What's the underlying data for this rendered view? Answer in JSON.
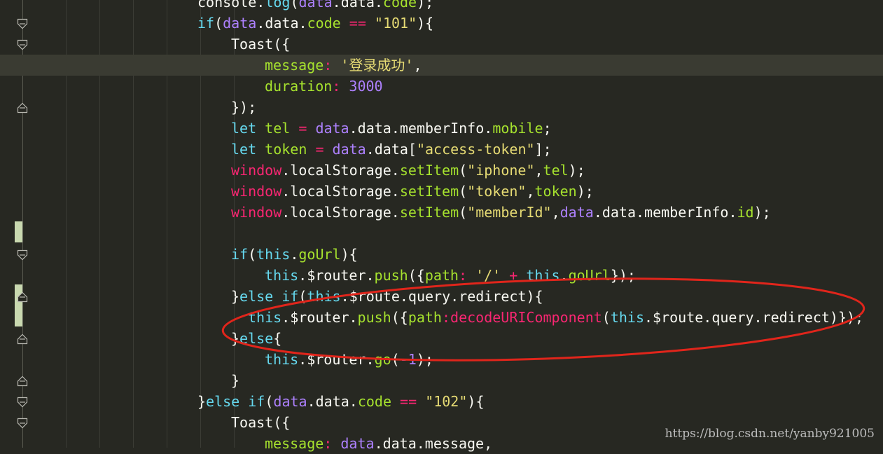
{
  "editor": {
    "lines": [
      {
        "tokens": [
          [
            "plain",
            "console."
          ],
          [
            "fn",
            "log"
          ],
          [
            "plain",
            "("
          ],
          [
            "var",
            "data"
          ],
          [
            "plain",
            ".data."
          ],
          [
            "prop",
            "code"
          ],
          [
            "plain",
            ");"
          ]
        ]
      },
      {
        "tokens": [
          [
            "kw",
            "if"
          ],
          [
            "plain",
            "("
          ],
          [
            "var",
            "data"
          ],
          [
            "plain",
            ".data."
          ],
          [
            "prop",
            "code"
          ],
          [
            "plain",
            " "
          ],
          [
            "mag",
            "=="
          ],
          [
            "plain",
            " "
          ],
          [
            "str",
            "\"101\""
          ],
          [
            "plain",
            "){"
          ]
        ]
      },
      {
        "tokens": [
          [
            "plain",
            "Toast({"
          ]
        ]
      },
      {
        "tokens": [
          [
            "prop",
            "message"
          ],
          [
            "mag",
            ":"
          ],
          [
            "plain",
            " "
          ],
          [
            "str",
            "'登录成功'"
          ],
          [
            "plain",
            ","
          ]
        ]
      },
      {
        "tokens": [
          [
            "prop",
            "duration"
          ],
          [
            "mag",
            ":"
          ],
          [
            "plain",
            " "
          ],
          [
            "num",
            "3000"
          ]
        ]
      },
      {
        "tokens": [
          [
            "plain",
            "});"
          ]
        ]
      },
      {
        "tokens": [
          [
            "kw",
            "let"
          ],
          [
            "plain",
            " "
          ],
          [
            "prop",
            "tel"
          ],
          [
            "plain",
            " "
          ],
          [
            "mag",
            "="
          ],
          [
            "plain",
            " "
          ],
          [
            "var",
            "data"
          ],
          [
            "plain",
            ".data.memberInfo."
          ],
          [
            "prop",
            "mobile"
          ],
          [
            "plain",
            ";"
          ]
        ]
      },
      {
        "tokens": [
          [
            "kw",
            "let"
          ],
          [
            "plain",
            " "
          ],
          [
            "prop",
            "token"
          ],
          [
            "plain",
            " "
          ],
          [
            "mag",
            "="
          ],
          [
            "plain",
            " "
          ],
          [
            "var",
            "data"
          ],
          [
            "plain",
            ".data["
          ],
          [
            "str",
            "\"access-token\""
          ],
          [
            "plain",
            "];"
          ]
        ]
      },
      {
        "tokens": [
          [
            "mag",
            "window"
          ],
          [
            "plain",
            ".localStorage."
          ],
          [
            "prop",
            "setItem"
          ],
          [
            "plain",
            "("
          ],
          [
            "str",
            "\"iphone\""
          ],
          [
            "plain",
            ","
          ],
          [
            "prop",
            "tel"
          ],
          [
            "plain",
            ");"
          ]
        ]
      },
      {
        "tokens": [
          [
            "mag",
            "window"
          ],
          [
            "plain",
            ".localStorage."
          ],
          [
            "prop",
            "setItem"
          ],
          [
            "plain",
            "("
          ],
          [
            "str",
            "\"token\""
          ],
          [
            "plain",
            ","
          ],
          [
            "prop",
            "token"
          ],
          [
            "plain",
            ");"
          ]
        ]
      },
      {
        "tokens": [
          [
            "mag",
            "window"
          ],
          [
            "plain",
            ".localStorage."
          ],
          [
            "prop",
            "setItem"
          ],
          [
            "plain",
            "("
          ],
          [
            "str",
            "\"memberId\""
          ],
          [
            "plain",
            ","
          ],
          [
            "var",
            "data"
          ],
          [
            "plain",
            ".data.memberInfo."
          ],
          [
            "prop",
            "id"
          ],
          [
            "plain",
            ");"
          ]
        ]
      },
      {
        "tokens": []
      },
      {
        "tokens": [
          [
            "kw",
            "if"
          ],
          [
            "plain",
            "("
          ],
          [
            "kw",
            "this"
          ],
          [
            "plain",
            "."
          ],
          [
            "prop",
            "goUrl"
          ],
          [
            "plain",
            "){"
          ]
        ]
      },
      {
        "tokens": [
          [
            "kw",
            "this"
          ],
          [
            "plain",
            ".$router."
          ],
          [
            "prop",
            "push"
          ],
          [
            "plain",
            "({"
          ],
          [
            "prop",
            "path"
          ],
          [
            "mag",
            ":"
          ],
          [
            "plain",
            " "
          ],
          [
            "str",
            "'/'"
          ],
          [
            "plain",
            " "
          ],
          [
            "mag",
            "+"
          ],
          [
            "plain",
            " "
          ],
          [
            "kw",
            "this"
          ],
          [
            "plain",
            "."
          ],
          [
            "prop",
            "goUrl"
          ],
          [
            "plain",
            "});"
          ]
        ]
      },
      {
        "tokens": [
          [
            "plain",
            "}"
          ],
          [
            "kw",
            "else"
          ],
          [
            "plain",
            " "
          ],
          [
            "kw",
            "if"
          ],
          [
            "plain",
            "("
          ],
          [
            "kw",
            "this"
          ],
          [
            "plain",
            ".$route.query.redirect){"
          ]
        ]
      },
      {
        "tokens": [
          [
            "kw",
            "this"
          ],
          [
            "plain",
            ".$router."
          ],
          [
            "prop",
            "push"
          ],
          [
            "plain",
            "({"
          ],
          [
            "prop",
            "path"
          ],
          [
            "mag",
            ":"
          ],
          [
            "mag",
            "decodeURIComponent"
          ],
          [
            "plain",
            "("
          ],
          [
            "kw",
            "this"
          ],
          [
            "plain",
            ".$route.query.redirect)});"
          ]
        ]
      },
      {
        "tokens": [
          [
            "plain",
            "}"
          ],
          [
            "kw",
            "else"
          ],
          [
            "plain",
            "{"
          ]
        ]
      },
      {
        "tokens": [
          [
            "kw",
            "this"
          ],
          [
            "plain",
            ".$router."
          ],
          [
            "prop",
            "go"
          ],
          [
            "plain",
            "("
          ],
          [
            "num",
            "-1"
          ],
          [
            "plain",
            ");"
          ]
        ]
      },
      {
        "tokens": [
          [
            "plain",
            "}"
          ]
        ]
      },
      {
        "tokens": [
          [
            "plain",
            "}"
          ],
          [
            "kw",
            "else"
          ],
          [
            "plain",
            " "
          ],
          [
            "kw",
            "if"
          ],
          [
            "plain",
            "("
          ],
          [
            "var",
            "data"
          ],
          [
            "plain",
            ".data."
          ],
          [
            "prop",
            "code"
          ],
          [
            "plain",
            " "
          ],
          [
            "mag",
            "=="
          ],
          [
            "plain",
            " "
          ],
          [
            "str",
            "\"102\""
          ],
          [
            "plain",
            "){"
          ]
        ]
      },
      {
        "tokens": [
          [
            "plain",
            "Toast({"
          ]
        ]
      },
      {
        "tokens": [
          [
            "prop",
            "message"
          ],
          [
            "mag",
            ":"
          ],
          [
            "plain",
            " "
          ],
          [
            "var",
            "data"
          ],
          [
            "plain",
            ".data.message,"
          ]
        ]
      }
    ],
    "highlight_color": "#e0251b"
  },
  "watermark": "https://blog.csdn.net/yanby921005"
}
